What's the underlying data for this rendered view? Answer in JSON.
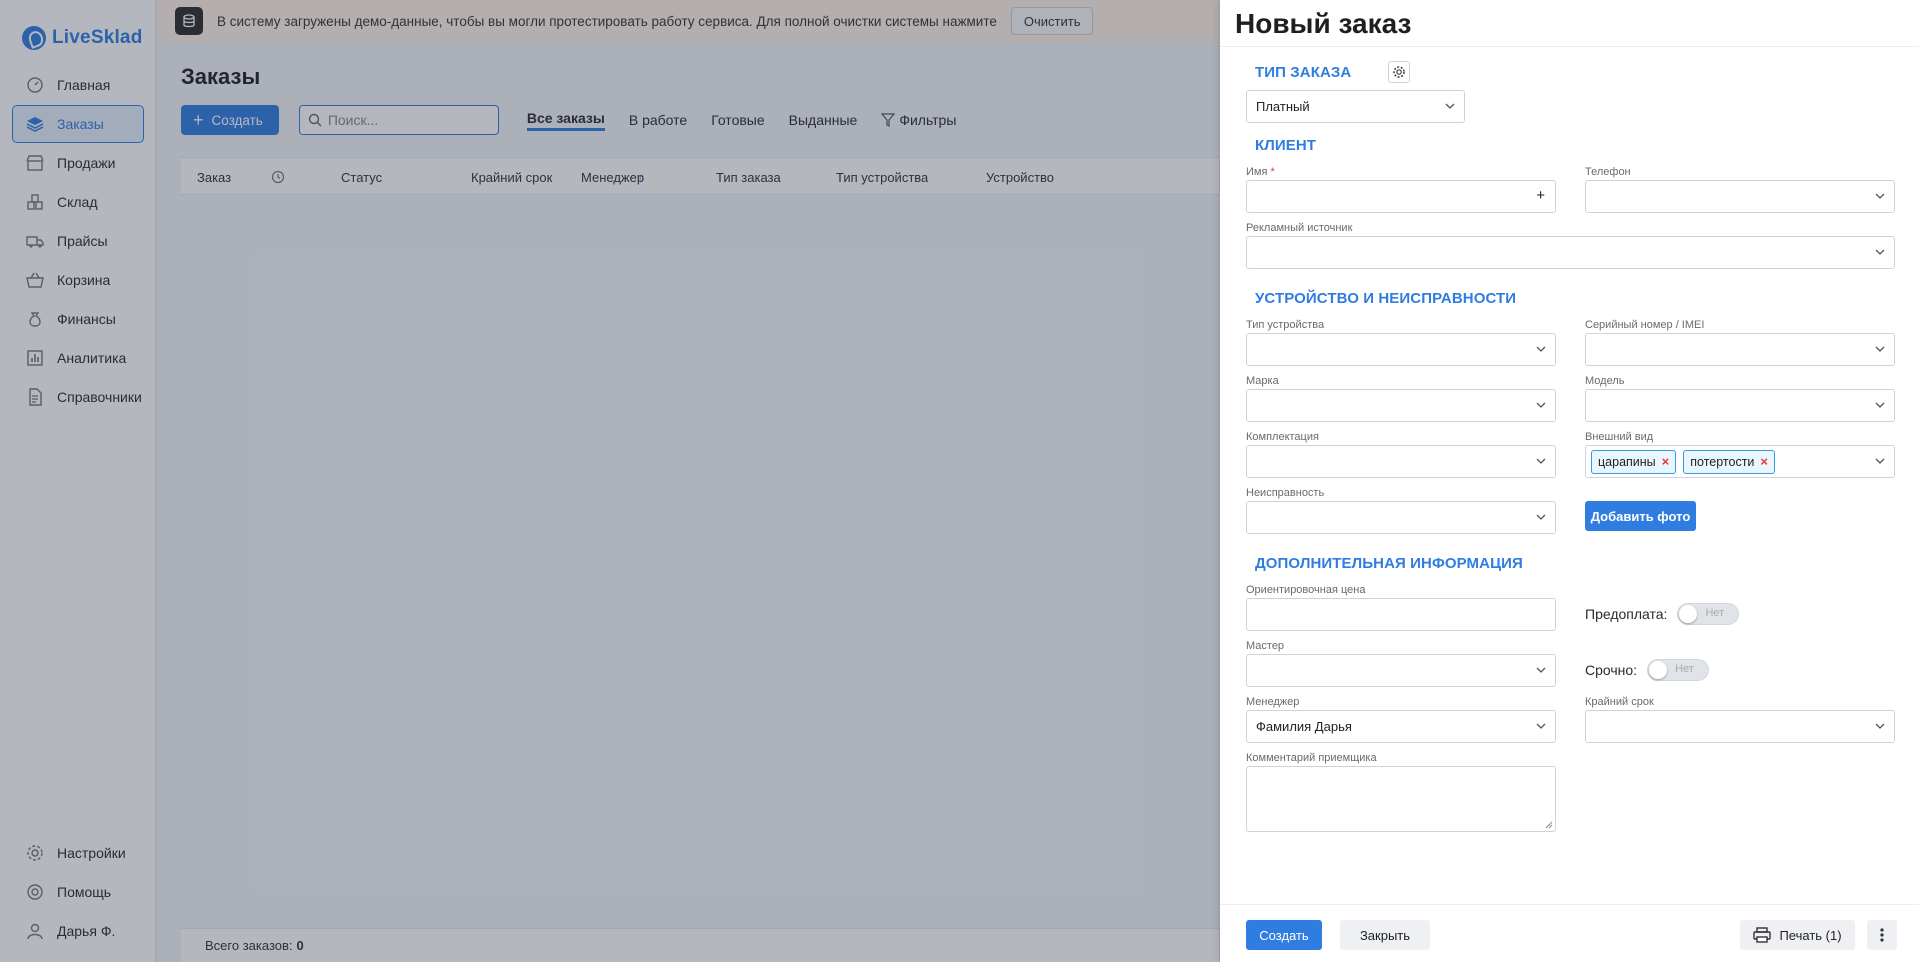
{
  "app": {
    "name": "LiveSklad"
  },
  "sidebar": {
    "items": [
      {
        "label": "Главная",
        "icon": "gauge-icon"
      },
      {
        "label": "Заказы",
        "icon": "layers-icon",
        "active": true
      },
      {
        "label": "Продажи",
        "icon": "store-icon"
      },
      {
        "label": "Склад",
        "icon": "warehouse-icon"
      },
      {
        "label": "Прайсы",
        "icon": "truck-icon"
      },
      {
        "label": "Корзина",
        "icon": "basket-icon"
      },
      {
        "label": "Финансы",
        "icon": "money-bag-icon"
      },
      {
        "label": "Аналитика",
        "icon": "bar-chart-icon"
      },
      {
        "label": "Справочники",
        "icon": "document-icon"
      }
    ],
    "bottom_items": [
      {
        "label": "Настройки",
        "icon": "gear-icon"
      },
      {
        "label": "Помощь",
        "icon": "help-icon"
      },
      {
        "label": "Дарья Ф.",
        "icon": "user-icon"
      }
    ]
  },
  "banner": {
    "text": "В систему загружены демо-данные, чтобы вы могли протестировать работу сервиса. Для полной очистки системы нажмите",
    "button": "Очистить"
  },
  "orders": {
    "title": "Заказы",
    "create_button": "Создать",
    "search_placeholder": "Поиск...",
    "tabs": [
      "Все заказы",
      "В работе",
      "Готовые",
      "Выданные"
    ],
    "filter_label": "Фильтры",
    "columns": [
      "Заказ",
      "Статус",
      "Крайний срок",
      "Менеджер",
      "Тип заказа",
      "Тип устройства",
      "Устройство"
    ],
    "total_label": "Всего заказов:",
    "total_value": "0"
  },
  "drawer": {
    "title": "Новый заказ",
    "sections": {
      "order_type": "ТИП ЗАКАЗА",
      "client": "КЛИЕНТ",
      "device": "УСТРОЙСТВО И НЕИСПРАВНОСТИ",
      "extra": "ДОПОЛНИТЕЛЬНАЯ ИНФОРМАЦИЯ"
    },
    "order_type_value": "Платный",
    "fields": {
      "name_label": "Имя",
      "name_required_mark": "*",
      "phone_label": "Телефон",
      "ad_source_label": "Рекламный источник",
      "device_type_label": "Тип устройства",
      "serial_label": "Серийный номер / IMEI",
      "brand_label": "Марка",
      "model_label": "Модель",
      "kit_label": "Комплектация",
      "appearance_label": "Внешний вид",
      "appearance_chips": [
        "царапины",
        "потертости"
      ],
      "fault_label": "Неисправность",
      "add_photo_button": "Добавить фото",
      "price_label": "Ориентировочная цена",
      "prepay_label": "Предоплата:",
      "prepay_state": "Нет",
      "master_label": "Мастер",
      "urgent_label": "Срочно:",
      "urgent_state": "Нет",
      "manager_label": "Менеджер",
      "manager_value": "Фамилия Дарья",
      "deadline_label": "Крайний срок",
      "comment_label": "Комментарий приемщика"
    },
    "footer": {
      "create_button": "Создать",
      "close_button": "Закрыть",
      "print_button": "Печать (1)"
    }
  },
  "colors": {
    "accent": "#2f7de1",
    "chip_border": "#2f9ee1",
    "required": "#e53935"
  }
}
